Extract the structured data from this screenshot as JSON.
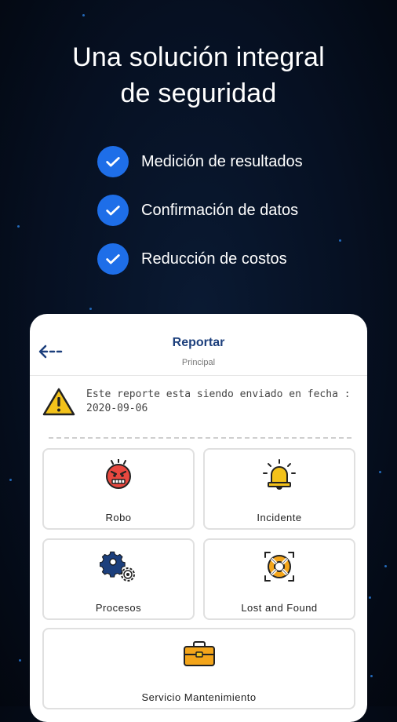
{
  "headline": {
    "line1": "Una solución integral",
    "line2": "de seguridad"
  },
  "features": [
    {
      "label": "Medición de resultados",
      "icon": "check-circle-icon"
    },
    {
      "label": "Confirmación de datos",
      "icon": "check-circle-icon"
    },
    {
      "label": "Reducción de costos",
      "icon": "check-circle-icon"
    }
  ],
  "app": {
    "header": {
      "title": "Reportar",
      "subtitle": "Principal",
      "back_icon": "arrow-left-icon"
    },
    "notice": {
      "icon": "warning-icon",
      "text": "Este reporte esta siendo enviado en fecha :",
      "date": "2020-09-06"
    },
    "tiles": [
      {
        "label": "Robo",
        "icon": "angry-face-icon"
      },
      {
        "label": "Incidente",
        "icon": "alarm-bell-icon"
      },
      {
        "label": "Procesos",
        "icon": "gears-icon"
      },
      {
        "label": "Lost and Found",
        "icon": "lifebuoy-icon"
      },
      {
        "label": "Servicio Mantenimiento",
        "icon": "toolbox-icon"
      }
    ]
  },
  "colors": {
    "accent_blue": "#1e6ee8",
    "header_title": "#1c3f7c",
    "background": "#061022"
  }
}
